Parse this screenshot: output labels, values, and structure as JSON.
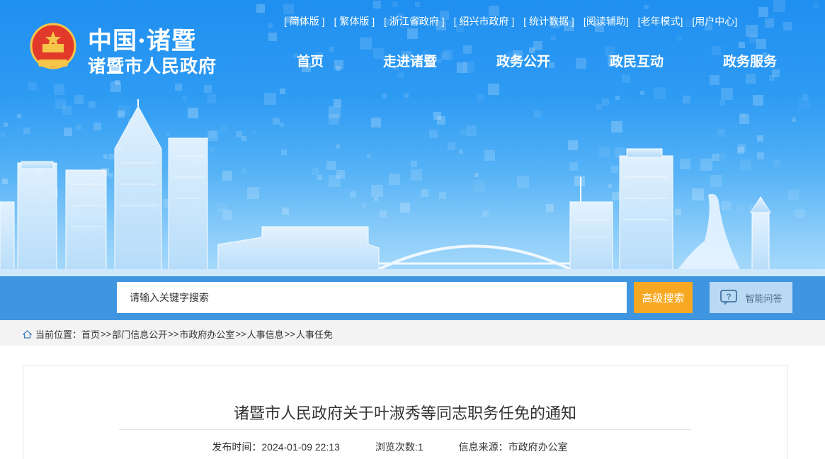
{
  "site": {
    "brand_top": "中国·诸暨",
    "brand_bottom": "诸暨市人民政府",
    "emblem_icon": "national-emblem-icon"
  },
  "top_links": [
    "[ 简体版 ]",
    "[ 繁体版 ]",
    "[ 浙江省政府 ]",
    "[ 绍兴市政府 ]",
    "[ 统计数据 ]",
    "[阅读辅助]",
    "[老年模式]",
    "[用户中心]"
  ],
  "main_nav": [
    "首页",
    "走进诸暨",
    "政务公开",
    "政民互动",
    "政务服务"
  ],
  "search": {
    "placeholder": "请输入关键字搜索",
    "advanced_label": "高级搜索",
    "qa_label": "智能问答",
    "qa_icon": "chat-question-icon"
  },
  "breadcrumb": {
    "prefix": "当前位置：",
    "items": [
      "首页",
      "部门信息公开",
      "市政府办公室",
      "人事信息",
      "人事任免"
    ],
    "separator": ">>"
  },
  "article": {
    "title": "诸暨市人民政府关于叶淑秀等同志职务任免的通知",
    "publish_label": "发布时间：",
    "publish_time": "2024-01-09 22:13",
    "views_label": "浏览次数:",
    "views": "1",
    "source_label": "信息来源：",
    "source": "市政府办公室"
  },
  "colors": {
    "banner_top": "#1f8ff0",
    "search_band": "#3f95e0",
    "advanced_button": "#f7a823",
    "qa_button": "#b9d9f5"
  }
}
